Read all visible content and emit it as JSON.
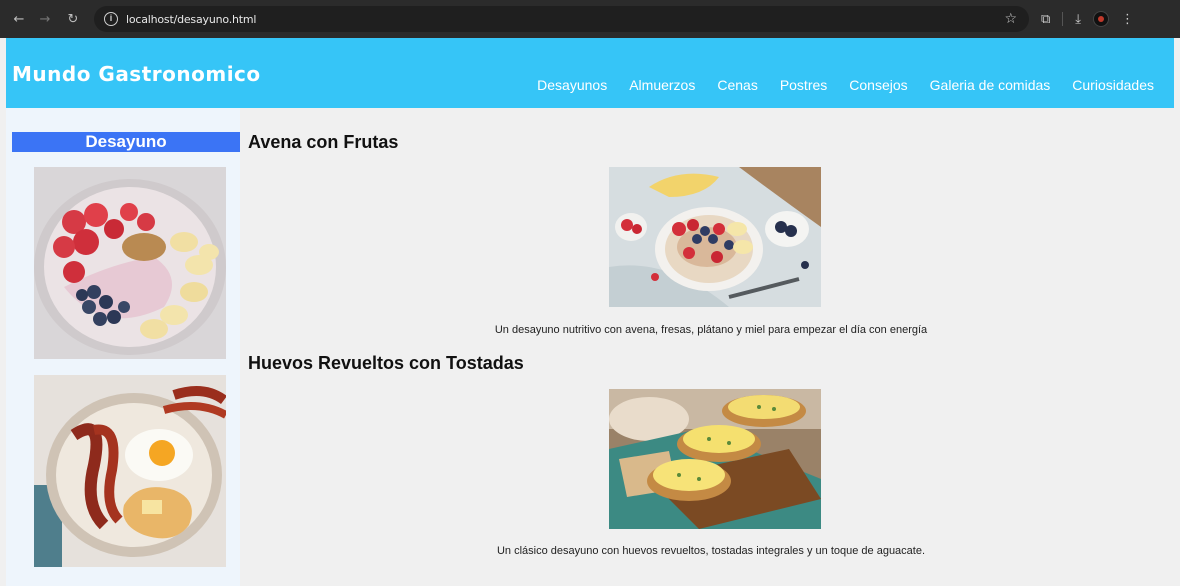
{
  "browser": {
    "url": "localhost/desayuno.html",
    "back_glyph": "←",
    "forward_glyph": "→",
    "reload_glyph": "↻",
    "info_glyph": "i",
    "star_glyph": "☆",
    "extensions_glyph": "⧉",
    "download_glyph": "⤓",
    "menu_glyph": "⋮"
  },
  "header": {
    "logo": "Mundo Gastronomico",
    "background": "#36c5f7",
    "menu": [
      {
        "label": "Desayunos"
      },
      {
        "label": "Almuerzos"
      },
      {
        "label": "Cenas"
      },
      {
        "label": "Postres"
      },
      {
        "label": "Consejos"
      },
      {
        "label": "Galeria de comidas"
      },
      {
        "label": "Curiosidades"
      }
    ]
  },
  "sidebar": {
    "title": "Desayuno",
    "title_color": "#3b74f5",
    "images": [
      {
        "icon": "yogurt-bowl-image"
      },
      {
        "icon": "bacon-egg-plate-image"
      }
    ]
  },
  "main": {
    "articles": [
      {
        "title": "Avena con Frutas",
        "caption": "Un desayuno nutritivo con avena, fresas, plátano y miel para empezar el día con energía",
        "icon": "oatmeal-fruit-image"
      },
      {
        "title": "Huevos Revueltos con Tostadas",
        "caption": "Un clásico desayuno con huevos revueltos, tostadas integrales y un toque de aguacate.",
        "icon": "scrambled-eggs-toast-image"
      }
    ]
  }
}
